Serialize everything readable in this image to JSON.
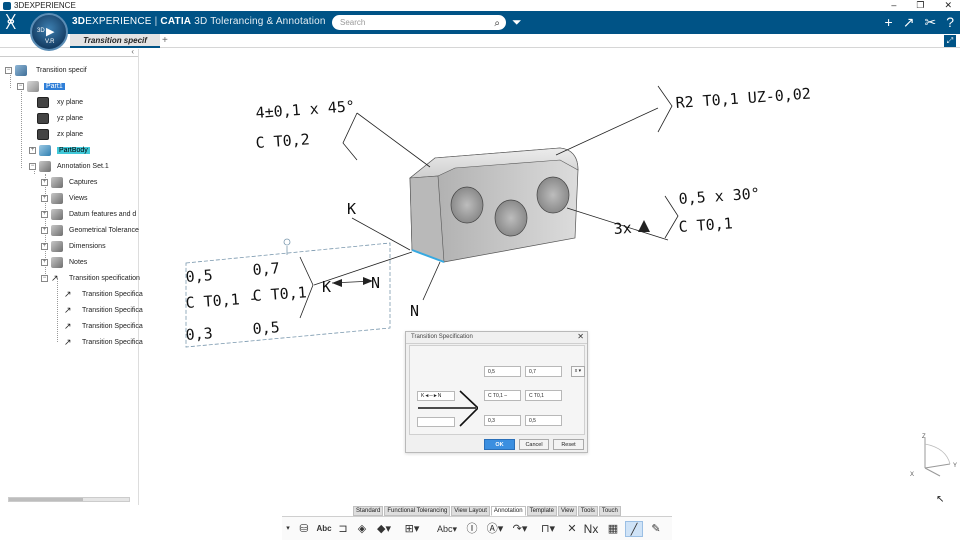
{
  "window": {
    "title": "3DEXPERIENCE",
    "controls": [
      "–",
      "❐",
      "✕"
    ]
  },
  "topbar": {
    "brand_3d": "3D",
    "brand_experience": "EXPERIENCE",
    "brand_separator": " | ",
    "brand_catia": "CATIA",
    "app_name": "3D Tolerancing & Annotation",
    "search_placeholder": "Search",
    "compass_label": "3D",
    "compass_version": "V.R",
    "accent_color": "#005386"
  },
  "tabs": [
    {
      "label": "Transition specif"
    }
  ],
  "tree": {
    "root": "Transition specif",
    "part": "Part1",
    "planes": [
      "xy plane",
      "yz plane",
      "zx plane"
    ],
    "partbody": "PartBody",
    "annotation_set": "Annotation Set.1",
    "annotation_children": [
      "Captures",
      "Views",
      "Datum features and d",
      "Geometrical Tolerance",
      "Dimensions",
      "Notes",
      "Transition specification"
    ],
    "transition_children": [
      "Transition Specifica",
      "Transition Specifica",
      "Transition Specifica",
      "Transition Specifica"
    ]
  },
  "drawing": {
    "chamfer_line1": "4±0,1 x 45°",
    "chamfer_line2": "C T0,2",
    "radius": "R2 T0,1 UZ-0,02",
    "right_line1": "0,5 x 30°",
    "right_count": "3x",
    "right_line2": "C T0,1",
    "label_k": "K",
    "label_n": "N",
    "spec_kn_k": "K",
    "spec_kn_n": "N",
    "spec_top_left": "0,5",
    "spec_top_right": "0,7",
    "spec_mid_left": "C T0,1 -",
    "spec_mid_right": "C T0,1",
    "spec_bot_left": "0,3",
    "spec_bot_right": "0,5"
  },
  "dialog": {
    "title": "Transition Specification",
    "selector": "x",
    "kn_label": "K◄─►N",
    "fields": {
      "top_left": "0,5",
      "top_right": "0,7",
      "mid_left": "C T0,1 –",
      "mid_right": "C T0,1",
      "bot_left": "0,3",
      "bot_right": "0,5"
    },
    "ok": "OK",
    "cancel": "Cancel",
    "reset": "Reset"
  },
  "bottom_tabs": [
    "Standard",
    "Functional Tolerancing",
    "View Layout",
    "Annotation",
    "Template",
    "View",
    "Tools",
    "Touch"
  ],
  "active_bottom_tab": "Annotation",
  "toolbar_icons": [
    "capture-icon",
    "text-icon",
    "datum-icon",
    "view-icon",
    "view-plane-icon",
    "dimension-icon",
    "text-abc-icon",
    "datum-target-icon",
    "leader-icon",
    "frame-icon",
    "flag-icon",
    "roughness-icon",
    "weld-icon",
    "nx-icon",
    "table-icon",
    "transition-spec-icon",
    "paint-icon"
  ],
  "toolbar_labels": {
    "abc": "Abc",
    "abc2": "Abc",
    "nx": "Nx"
  },
  "triad": {
    "z": "Z",
    "y": "Y",
    "x": "X"
  }
}
